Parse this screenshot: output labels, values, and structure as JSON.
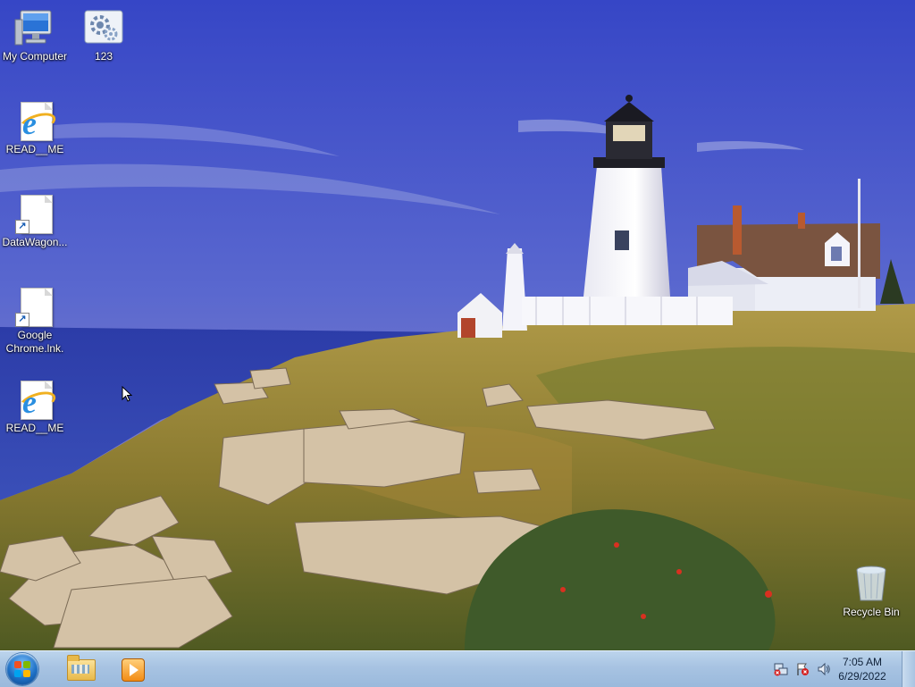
{
  "desktop": {
    "icons": [
      {
        "label": "My Computer",
        "icon": "computer-icon"
      },
      {
        "label": "123",
        "icon": "settings-gear-icon"
      },
      {
        "label": "READ__ME",
        "icon": "ie-html-icon"
      },
      {
        "label": "DataWagon...",
        "icon": "shortcut-file-icon"
      },
      {
        "label": "Google Chrome.lnk.",
        "icon": "shortcut-file-icon"
      },
      {
        "label": "READ__ME",
        "icon": "ie-html-icon"
      },
      {
        "label": "Recycle Bin",
        "icon": "recycle-bin-icon"
      }
    ],
    "wallpaper": "lighthouse-coast"
  },
  "taskbar": {
    "start_button": "start-orb",
    "pinned": [
      {
        "name": "windows-explorer",
        "icon": "folder-icon"
      },
      {
        "name": "media-player",
        "icon": "media-player-icon"
      }
    ],
    "tray": {
      "icons": [
        "network-icon",
        "action-center-flag-icon",
        "volume-icon"
      ],
      "time": "7:05 AM",
      "date": "6/29/2022"
    }
  },
  "colors": {
    "taskbar": "#a7c3e2",
    "sky_top": "#3f4fc8",
    "sea": "#2b3fb0",
    "grass": "#9a8a3a"
  }
}
